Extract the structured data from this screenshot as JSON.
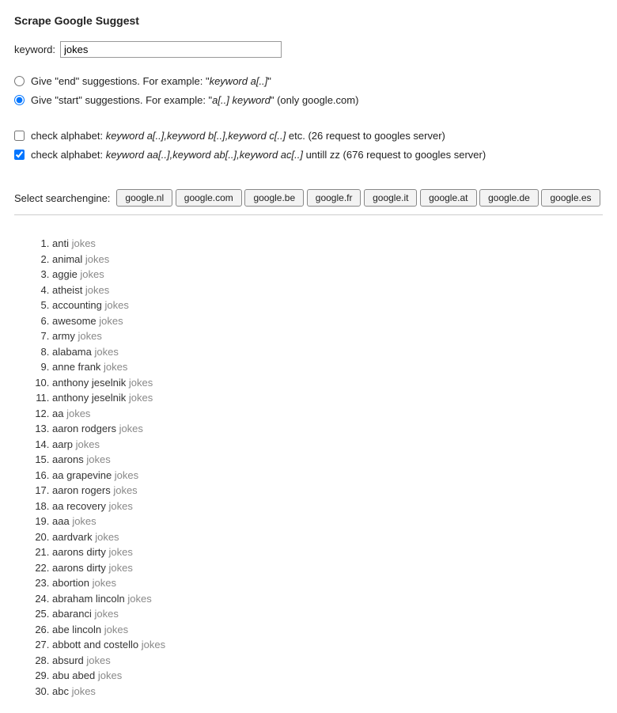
{
  "title": "Scrape Google Suggest",
  "keyword": {
    "label": "keyword:",
    "value": "jokes"
  },
  "suggestion_mode": {
    "end": {
      "label_before": "Give \"end\" suggestions. For example: \"",
      "example": "keyword a[..]",
      "label_after": "\"",
      "checked": false
    },
    "start": {
      "label_before": "Give \"start\" suggestions. For example: \"",
      "example": "a[..] keyword",
      "label_after": "\" (only google.com)",
      "checked": true
    }
  },
  "alphabet": {
    "single": {
      "label_before": "check alphabet: ",
      "example": "keyword a[..],keyword b[..],keyword c[..]",
      "label_after": " etc. (26 request to googles server)",
      "checked": false
    },
    "double": {
      "label_before": "check alphabet: ",
      "example": "keyword aa[..],keyword ab[..],keyword ac[..]",
      "label_after": " untill zz (676 request to googles server)",
      "checked": true
    }
  },
  "engine": {
    "label": "Select searchengine:",
    "buttons": [
      "google.nl",
      "google.com",
      "google.be",
      "google.fr",
      "google.it",
      "google.at",
      "google.de",
      "google.es"
    ]
  },
  "results_keyword": "jokes",
  "results": [
    "anti",
    "animal",
    "aggie",
    "atheist",
    "accounting",
    "awesome",
    "army",
    "alabama",
    "anne frank",
    "anthony jeselnik",
    "anthony jeselnik",
    "aa",
    "aaron rodgers",
    "aarp",
    "aarons",
    "aa grapevine",
    "aaron rogers",
    "aa recovery",
    "aaa",
    "aardvark",
    "aarons dirty",
    "aarons dirty",
    "abortion",
    "abraham lincoln",
    "abaranci",
    "abe lincoln",
    "abbott and costello",
    "absurd",
    "abu abed",
    "abc"
  ]
}
